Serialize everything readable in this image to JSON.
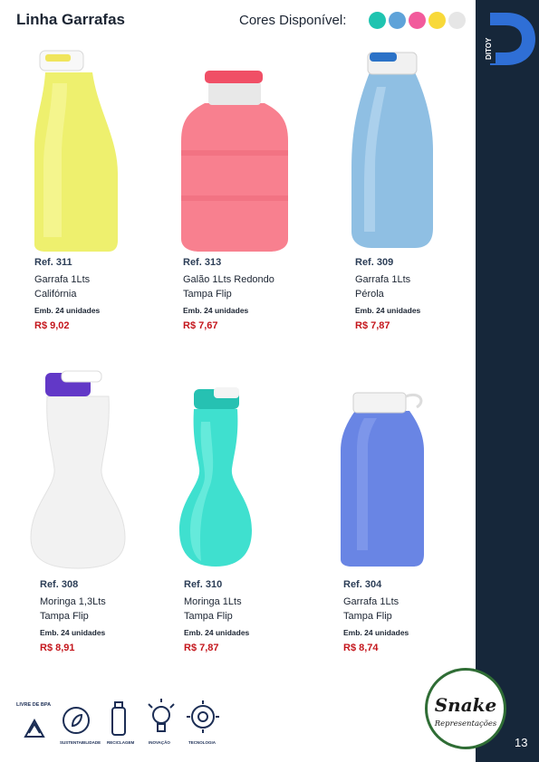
{
  "header": {
    "title": "Linha Garrafas",
    "colors_label": "Cores Disponível:",
    "colors": [
      "#1fc4b0",
      "#5fa3d9",
      "#f25b9c",
      "#f8d939",
      "#e6e6e6"
    ]
  },
  "brand": {
    "logo_text": "DITOY"
  },
  "products": [
    {
      "ref": "Ref. 311",
      "name": "Garrafa 1Lts\nCalifórnia",
      "pack": "Emb. 24 unidades",
      "price": "R$ 9,02"
    },
    {
      "ref": "Ref. 313",
      "name": "Galão 1Lts Redondo\nTampa Flip",
      "pack": "Emb. 24 unidades",
      "price": "R$ 7,67"
    },
    {
      "ref": "Ref. 309",
      "name": "Garrafa 1Lts\nPérola",
      "pack": "Emb. 24 unidades",
      "price": "R$ 7,87"
    },
    {
      "ref": "Ref. 308",
      "name": "Moringa 1,3Lts\nTampa Flip",
      "pack": "Emb. 24 unidades",
      "price": "R$ 8,91"
    },
    {
      "ref": "Ref. 310",
      "name": "Moringa 1Lts\nTampa Flip",
      "pack": "Emb. 24 unidades",
      "price": "R$ 7,87"
    },
    {
      "ref": "Ref. 304",
      "name": "Garrafa 1Lts\nTampa Flip",
      "pack": "Emb. 24 unidades",
      "price": "R$ 8,74"
    }
  ],
  "icons": [
    {
      "icon": "recycle-bpa-icon",
      "label": "LIVRE DE BPA"
    },
    {
      "icon": "sustainability-icon",
      "label": "SUSTENTABILIDADE"
    },
    {
      "icon": "recycling-bottle-icon",
      "label": "RECICLAGEM"
    },
    {
      "icon": "lightbulb-icon",
      "label": "INOVAÇÃO"
    },
    {
      "icon": "technology-icon",
      "label": "TECNOLOGIA"
    }
  ],
  "seal": {
    "line1": "Snake",
    "line2": "Representações"
  },
  "page_number": "13"
}
